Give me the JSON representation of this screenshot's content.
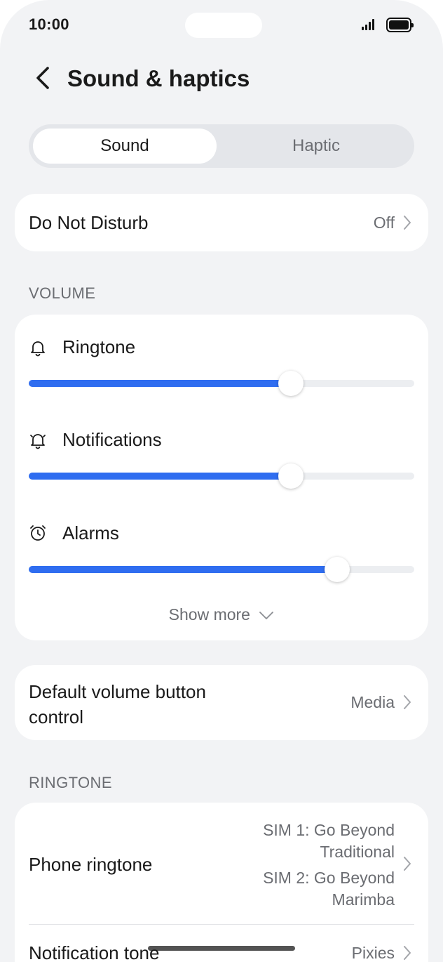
{
  "status": {
    "time": "10:00"
  },
  "header": {
    "title": "Sound & haptics",
    "back_icon": "chevron-left-icon"
  },
  "tabs": [
    {
      "label": "Sound",
      "active": true
    },
    {
      "label": "Haptic",
      "active": false
    }
  ],
  "dnd": {
    "label": "Do Not Disturb",
    "value": "Off"
  },
  "volume": {
    "section_label": "VOLUME",
    "items": [
      {
        "label": "Ringtone",
        "icon": "bell-icon",
        "level": 0.68
      },
      {
        "label": "Notifications",
        "icon": "notification-bell-icon",
        "level": 0.68
      },
      {
        "label": "Alarms",
        "icon": "alarm-clock-icon",
        "level": 0.8
      }
    ],
    "show_more": "Show more"
  },
  "volume_button": {
    "label_line1": "Default volume button",
    "label_line2": "control",
    "value": "Media"
  },
  "ringtone": {
    "section_label": "RINGTONE",
    "phone": {
      "label": "Phone ringtone",
      "sim1_line1": "SIM 1: Go Beyond",
      "sim1_line2": "Traditional",
      "sim2_line1": "SIM 2: Go Beyond",
      "sim2_line2": "Marimba"
    },
    "notification": {
      "label": "Notification tone",
      "value": "Pixies"
    }
  },
  "colors": {
    "accent": "#2f6df0",
    "background": "#f2f3f5",
    "card": "#ffffff"
  }
}
